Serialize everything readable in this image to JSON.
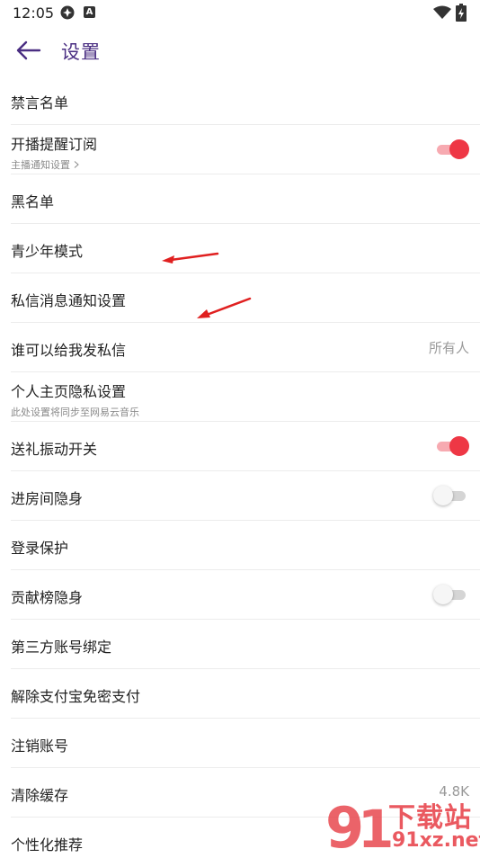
{
  "status_bar": {
    "time": "12:05",
    "badge_letter": "A"
  },
  "header": {
    "title": "设置"
  },
  "rows": [
    {
      "title": "禁言名单"
    },
    {
      "title": "开播提醒订阅",
      "subtitle": "主播通知设置",
      "toggle": "on"
    },
    {
      "title": "黑名单"
    },
    {
      "title": "青少年模式"
    },
    {
      "title": "私信消息通知设置"
    },
    {
      "title": "谁可以给我发私信",
      "value": "所有人"
    },
    {
      "title": "个人主页隐私设置",
      "subtitle": "此处设置将同步至网易云音乐"
    },
    {
      "title": "送礼振动开关",
      "toggle": "on"
    },
    {
      "title": "进房间隐身",
      "toggle": "off"
    },
    {
      "title": "登录保护"
    },
    {
      "title": "贡献榜隐身",
      "toggle": "off"
    },
    {
      "title": "第三方账号绑定"
    },
    {
      "title": "解除支付宝免密支付"
    },
    {
      "title": "注销账号"
    },
    {
      "title": "清除缓存",
      "value": "4.8K"
    },
    {
      "title": "个性化推荐"
    }
  ],
  "watermark": {
    "brand": "下载站",
    "site": "91xz.net"
  },
  "colors": {
    "accent": "#4a2e82",
    "toggle_on": "#ee3745",
    "annotation_arrow": "#e02020"
  }
}
